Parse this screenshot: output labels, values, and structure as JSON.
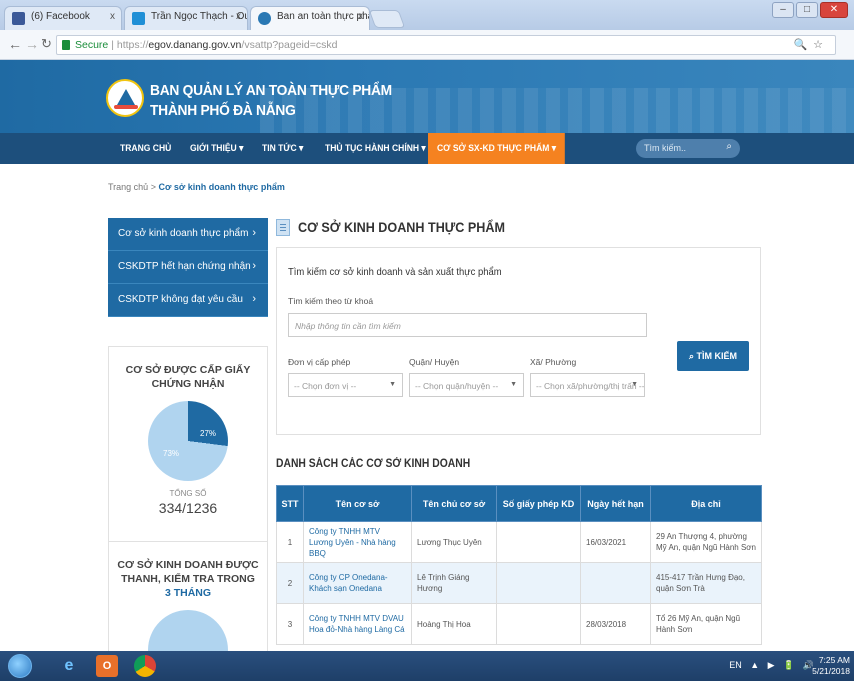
{
  "browser": {
    "tabs": [
      {
        "label": "(6) Facebook",
        "close": "x"
      },
      {
        "label": "Trần Ngọc Thạch - Outlo",
        "close": "x"
      },
      {
        "label": "Ban an toàn thực phẩm",
        "close": "x"
      }
    ],
    "secure_label": "Secure",
    "url_scheme": "https://",
    "url_host": "egov.danang.gov.vn",
    "url_path": "/vsattp?pageid=cskd",
    "window_controls": [
      "–",
      "□",
      "✕"
    ]
  },
  "site": {
    "title_line1": "BAN QUẢN LÝ AN TOÀN THỰC PHẨM",
    "title_line2": "THÀNH PHỐ ĐÀ NẴNG"
  },
  "nav": {
    "items": [
      "TRANG CHỦ",
      "GIỚI THIỆU ▾",
      "TIN TỨC ▾",
      "THỦ TỤC HÀNH CHÍNH ▾",
      "CƠ SỞ SX-KD THỰC PHẨM ▾"
    ],
    "search_placeholder": "Tìm kiếm.."
  },
  "breadcrumb": {
    "home": "Trang chủ",
    "separator": ">",
    "current": "Cơ sở kinh doanh thực phẩm"
  },
  "sidebar": {
    "items": [
      {
        "label": "Cơ sở kinh doanh thực phẩm"
      },
      {
        "label": "CSKDTP hết hạn chứng nhận"
      },
      {
        "label": "CSKDTP không đạt yêu cầu"
      }
    ],
    "box1": {
      "title": "CƠ SỞ ĐƯỢC CẤP GIẤY CHỨNG NHẬN",
      "pie_label_blue": "27%",
      "pie_label_light": "73%",
      "total_label": "TỔNG SỐ",
      "total_value": "334/1236"
    },
    "box2": {
      "title": "CƠ SỞ KINH DOANH ĐƯỢC THANH, KIỂM TRA TRONG",
      "title_highlight": "3 THÁNG"
    }
  },
  "main": {
    "title": "CƠ SỞ KINH DOANH THỰC PHẨM",
    "search": {
      "heading": "Tìm kiếm cơ sở kinh doanh và sản xuất thực phẩm",
      "keyword_label": "Tìm kiếm theo từ khoá",
      "keyword_placeholder": "Nhập thông tin cần tìm kiếm",
      "filters": [
        {
          "label": "Đơn vị cấp phép",
          "value": "-- Chọn đơn vị --"
        },
        {
          "label": "Quận/ Huyện",
          "value": "-- Chọn quận/huyện --"
        },
        {
          "label": "Xã/ Phường",
          "value": "-- Chọn xã/phường/thị trấn --"
        }
      ],
      "button_label": "TÌM KIẾM"
    },
    "list_title": "DANH SÁCH CÁC CƠ SỞ KINH DOANH",
    "table": {
      "headers": [
        "STT",
        "Tên cơ sở",
        "Tên chủ cơ sở",
        "Số giấy phép KD",
        "Ngày hết hạn",
        "Địa chỉ"
      ],
      "rows": [
        {
          "stt": "1",
          "name": "Công ty TNHH MTV Lương Uyên - Nhà hàng BBQ",
          "owner": "Lương Thục Uyên",
          "license": "",
          "expiry": "16/03/2021",
          "address": "29 An Thượng 4, phường Mỹ An, quận Ngũ Hành Sơn"
        },
        {
          "stt": "2",
          "name": "Công ty CP Onedana-Khách sạn Onedana",
          "owner": "Lê Trịnh Giáng Hương",
          "license": "",
          "expiry": "",
          "address": "415-417 Trần Hưng Đạo, quận Sơn Trà"
        },
        {
          "stt": "3",
          "name": "Công ty TNHH MTV DVAU Hoa đỏ-Nhà hàng Làng Cá",
          "owner": "Hoàng Thị Hoa",
          "license": "",
          "expiry": "28/03/2018",
          "address": "Tổ 26 Mỹ An, quận Ngũ Hành Sơn"
        }
      ]
    }
  },
  "taskbar": {
    "tray_text": "EN ▲ ▶ 🔋 🔊",
    "time": "7:25 AM",
    "date": "5/21/2018"
  },
  "colors": {
    "primary": "#1f6aa3",
    "nav_bg": "#1d4f7c",
    "accent_orange": "#f58220",
    "pie_light": "#b0d4ef"
  },
  "chart_data": {
    "type": "pie",
    "categories": [
      "27%",
      "73%"
    ],
    "values": [
      27,
      73
    ],
    "title": "CƠ SỞ ĐƯỢC CẤP GIẤY CHỨNG NHẬN"
  }
}
